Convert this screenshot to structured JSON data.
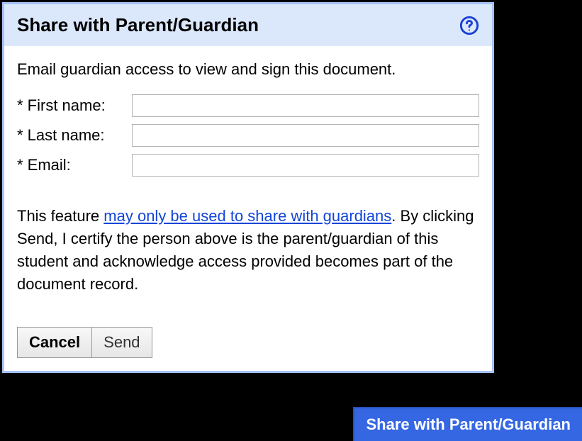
{
  "dialog": {
    "title": "Share with Parent/Guardian",
    "instruction": "Email guardian access to view and sign this document.",
    "fields": {
      "first_name": {
        "label": "* First name:",
        "value": ""
      },
      "last_name": {
        "label": "* Last name:",
        "value": ""
      },
      "email": {
        "label": "* Email:",
        "value": ""
      }
    },
    "disclaimer": {
      "pre": "This feature ",
      "link": "may only be used to share with guardians",
      "post": ". By clicking Send, I certify the person above is the parent/guardian of this student and acknowledge access provided becomes part of the document record."
    },
    "buttons": {
      "cancel": "Cancel",
      "send": "Send"
    }
  },
  "bottom_button": "Share with Parent/Guardian"
}
